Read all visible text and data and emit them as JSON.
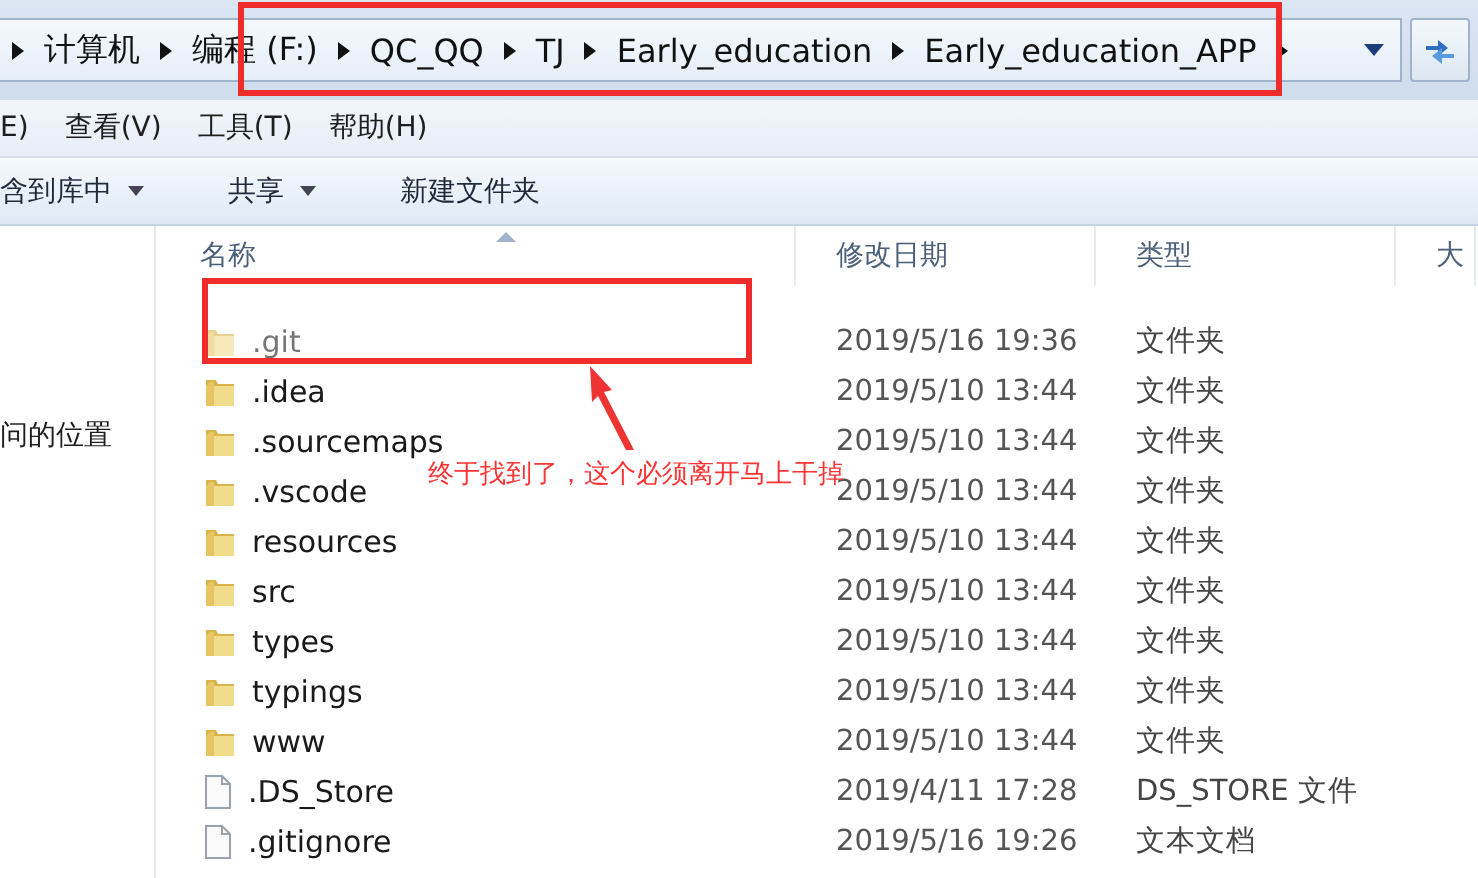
{
  "address_bar": {
    "crumbs": [
      "计算机",
      "编程 (F:)",
      "QC_QQ",
      "TJ",
      "Early_education",
      "Early_education_APP"
    ]
  },
  "menu_bar": [
    "E)",
    "查看(V)",
    "工具(T)",
    "帮助(H)"
  ],
  "toolbar": [
    {
      "label": "含到库中",
      "dropdown": true
    },
    {
      "label": "共享",
      "dropdown": true
    },
    {
      "label": "新建文件夹",
      "dropdown": false
    }
  ],
  "nav_pane": {
    "items": [
      "问的位置"
    ]
  },
  "table": {
    "columns": [
      "名称",
      "修改日期",
      "类型",
      "大"
    ],
    "rows": [
      {
        "kind": "folder",
        "name": ".git",
        "modified": "2019/5/16 19:36",
        "type": "文件夹",
        "hidden": true
      },
      {
        "kind": "folder",
        "name": ".idea",
        "modified": "2019/5/10 13:44",
        "type": "文件夹",
        "hidden": false
      },
      {
        "kind": "folder",
        "name": ".sourcemaps",
        "modified": "2019/5/10 13:44",
        "type": "文件夹",
        "hidden": false
      },
      {
        "kind": "folder",
        "name": ".vscode",
        "modified": "2019/5/10 13:44",
        "type": "文件夹",
        "hidden": false
      },
      {
        "kind": "folder",
        "name": "resources",
        "modified": "2019/5/10 13:44",
        "type": "文件夹",
        "hidden": false
      },
      {
        "kind": "folder",
        "name": "src",
        "modified": "2019/5/10 13:44",
        "type": "文件夹",
        "hidden": false
      },
      {
        "kind": "folder",
        "name": "types",
        "modified": "2019/5/10 13:44",
        "type": "文件夹",
        "hidden": false
      },
      {
        "kind": "folder",
        "name": "typings",
        "modified": "2019/5/10 13:44",
        "type": "文件夹",
        "hidden": false
      },
      {
        "kind": "folder",
        "name": "www",
        "modified": "2019/5/10 13:44",
        "type": "文件夹",
        "hidden": false
      },
      {
        "kind": "file",
        "name": ".DS_Store",
        "modified": "2019/4/11 17:28",
        "type": "DS_STORE 文件",
        "hidden": false
      },
      {
        "kind": "file",
        "name": ".gitignore",
        "modified": "2019/5/16 19:26",
        "type": "文本文档",
        "hidden": false
      }
    ]
  },
  "annotation": {
    "text": "终于找到了，这个必须离开马上干掉"
  }
}
